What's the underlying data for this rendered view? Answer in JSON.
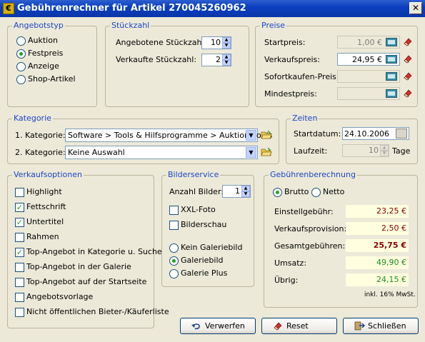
{
  "window": {
    "title": "Gebührenrechner für Artikel 270045260962",
    "close": "✕"
  },
  "angebotstyp": {
    "legend": "Angebotstyp",
    "options": [
      "Auktion",
      "Festpreis",
      "Anzeige",
      "Shop-Artikel"
    ],
    "selected": "Festpreis"
  },
  "stueckzahl": {
    "legend": "Stückzahl",
    "angeboten_label": "Angebotene Stückzahl:",
    "angeboten_value": "10",
    "verkauft_label": "Verkaufte Stückzahl:",
    "verkauft_value": "2"
  },
  "preise": {
    "legend": "Preise",
    "startpreis_label": "Startpreis:",
    "startpreis_value": "1,00 €",
    "verkaufspreis_label": "Verkaufspreis:",
    "verkaufspreis_value": "24,95 €",
    "sofortkaufen_label": "Sofortkaufen-Preis:",
    "sofortkaufen_value": "",
    "mindestpreis_label": "Mindestpreis:",
    "mindestpreis_value": ""
  },
  "kategorie": {
    "legend": "Kategorie",
    "kat1_label": "1. Kategorie:",
    "kat1_value": "Software > Tools & Hilfsprogramme > Auktionstools",
    "kat2_label": "2. Kategorie:",
    "kat2_value": "Keine Auswahl"
  },
  "zeiten": {
    "legend": "Zeiten",
    "startdatum_label": "Startdatum:",
    "startdatum_value": "24.10.2006",
    "laufzeit_label": "Laufzeit:",
    "laufzeit_value": "10",
    "laufzeit_unit": "Tage"
  },
  "verkaufsoptionen": {
    "legend": "Verkaufsoptionen",
    "items": [
      {
        "label": "Highlight",
        "checked": false
      },
      {
        "label": "Fettschrift",
        "checked": true
      },
      {
        "label": "Untertitel",
        "checked": true
      },
      {
        "label": "Rahmen",
        "checked": false
      },
      {
        "label": "Top-Angebot in Kategorie u. Suche",
        "checked": true
      },
      {
        "label": "Top-Angebot in der Galerie",
        "checked": false
      },
      {
        "label": "Top-Angebot auf der Startseite",
        "checked": false
      },
      {
        "label": "Angebotsvorlage",
        "checked": false
      },
      {
        "label": "Nicht öffentlichen Bieter-/Käuferliste",
        "checked": false
      }
    ]
  },
  "bilderservice": {
    "legend": "Bilderservice",
    "anzahl_label": "Anzahl Bilder:",
    "anzahl_value": "1",
    "xxl_label": "XXL-Foto",
    "bilderschau_label": "Bilderschau",
    "galerie_options": [
      "Kein Galeriebild",
      "Galeriebild",
      "Galerie Plus"
    ],
    "galerie_selected": "Galeriebild"
  },
  "gebuehren": {
    "legend": "Gebührenberechnung",
    "brutto_label": "Brutto",
    "netto_label": "Netto",
    "mode_selected": "Brutto",
    "einstell_label": "Einstellgebühr:",
    "einstell_value": "23,25 €",
    "provision_label": "Verkaufsprovision:",
    "provision_value": "2,50 €",
    "gesamt_label": "Gesamtgebühren:",
    "gesamt_value": "25,75 €",
    "umsatz_label": "Umsatz:",
    "umsatz_value": "49,90 €",
    "uebrig_label": "Übrig:",
    "uebrig_value": "24,15 €",
    "mwst_note": "inkl. 16% MwSt."
  },
  "buttons": {
    "verwerfen": "Verwerfen",
    "reset": "Reset",
    "schliessen": "Schließen"
  }
}
